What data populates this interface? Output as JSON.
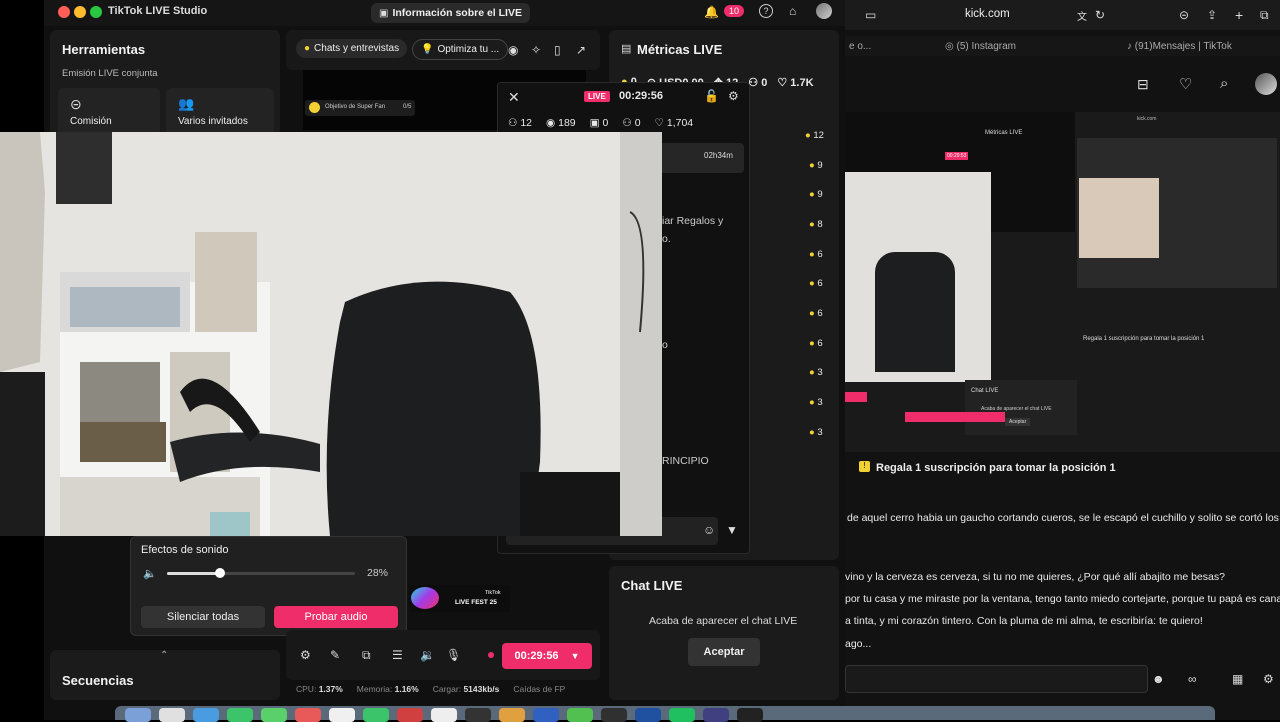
{
  "studio": {
    "app_title": "TikTok LIVE Studio",
    "live_info_label": "Información sobre el LIVE",
    "notification_count": "10",
    "tools": {
      "title": "Herramientas",
      "section": "Emisión LIVE conjunta",
      "items": [
        {
          "label": "Comisión",
          "icon": "link-icon"
        },
        {
          "label": "Varios invitados",
          "icon": "users-icon"
        }
      ]
    },
    "center_tabs": {
      "chats_label": "Chats y entrevistas",
      "optimize_label": "Optimiza tu ..."
    },
    "super_fan": {
      "label": "Objetivo de Super Fan",
      "count": "0/5"
    },
    "metrics": {
      "title": "Métricas LIVE",
      "row": [
        {
          "icon": "coin-icon",
          "value": "0"
        },
        {
          "icon": "dollar-icon",
          "value": "USD0.00"
        },
        {
          "icon": "gift-icon",
          "value": "12"
        },
        {
          "icon": "user-plus-icon",
          "value": "0"
        },
        {
          "icon": "heart-icon",
          "value": "1.7K"
        }
      ],
      "gift_counts": [
        "12",
        "9",
        "9",
        "8",
        "6",
        "6",
        "6",
        "6",
        "3",
        "3",
        "3"
      ],
      "duration": "02h34m",
      "text_fragments": [
        "iar Regalos y",
        "o.",
        "o",
        "RINCIPIO"
      ]
    },
    "overlay": {
      "live_badge": "LIVE",
      "timer": "00:29:56",
      "stats": [
        {
          "icon": "users-icon",
          "value": "12"
        },
        {
          "icon": "eye-icon",
          "value": "189"
        },
        {
          "icon": "gift-icon",
          "value": "0"
        },
        {
          "icon": "user-plus-icon",
          "value": "0"
        },
        {
          "icon": "heart-icon",
          "value": "1,704"
        }
      ]
    },
    "sound": {
      "title": "Efectos de sonido",
      "volume": "28%",
      "volume_fraction": 0.28,
      "mute_all": "Silenciar todas",
      "test_audio": "Probar audio"
    },
    "fest_label": "LIVE FEST 25",
    "fest_brand": "TikTok",
    "sequences_title": "Secuencias",
    "controls": {
      "timer": "00:29:56"
    },
    "status": {
      "cpu_label": "CPU:",
      "cpu_value": "1.37%",
      "mem_label": "Memoria:",
      "mem_value": "1.16%",
      "load_label": "Cargar:",
      "load_value": "5143kb/s",
      "drops_label": "Caídas de FP"
    },
    "chat": {
      "title": "Chat LIVE",
      "message": "Acaba de aparecer el chat LIVE",
      "accept": "Aceptar"
    }
  },
  "browser": {
    "url": "kick.com",
    "tabs": [
      {
        "label": "e o..."
      },
      {
        "label": "(5) Instagram"
      },
      {
        "label": "(91)Mensajes | TikTok"
      }
    ],
    "pinned": "Regala 1 suscripción para tomar la posición 1",
    "chat_lines": [
      "de aquel cerro habia un gaucho cortando cueros, se le escapó el cuchillo y solito se cortó los",
      "vino y la cerveza es cerveza, si tu no me quieres, ¿Por qué allí abajito me besas?",
      "por tu casa y me miraste por la ventana, tengo tanto miedo cortejarte, porque tu papá es cana",
      "a tinta, y mi corazón tintero. Con la pluma de mi alma, te escribiría: te quiero!",
      "ago..."
    ],
    "mini": {
      "pinned": "Regala 1 suscripción para tomar la posición 1",
      "chat_title": "Chat LIVE",
      "chat_msg": "Acaba de aparecer el chat LIVE",
      "accept": "Aceptar",
      "metrics": "Métricas LIVE",
      "timer": "00:29:53",
      "url": "kick.com"
    }
  },
  "colors": {
    "accent": "#ef2d6a",
    "coin": "#f2d233"
  }
}
